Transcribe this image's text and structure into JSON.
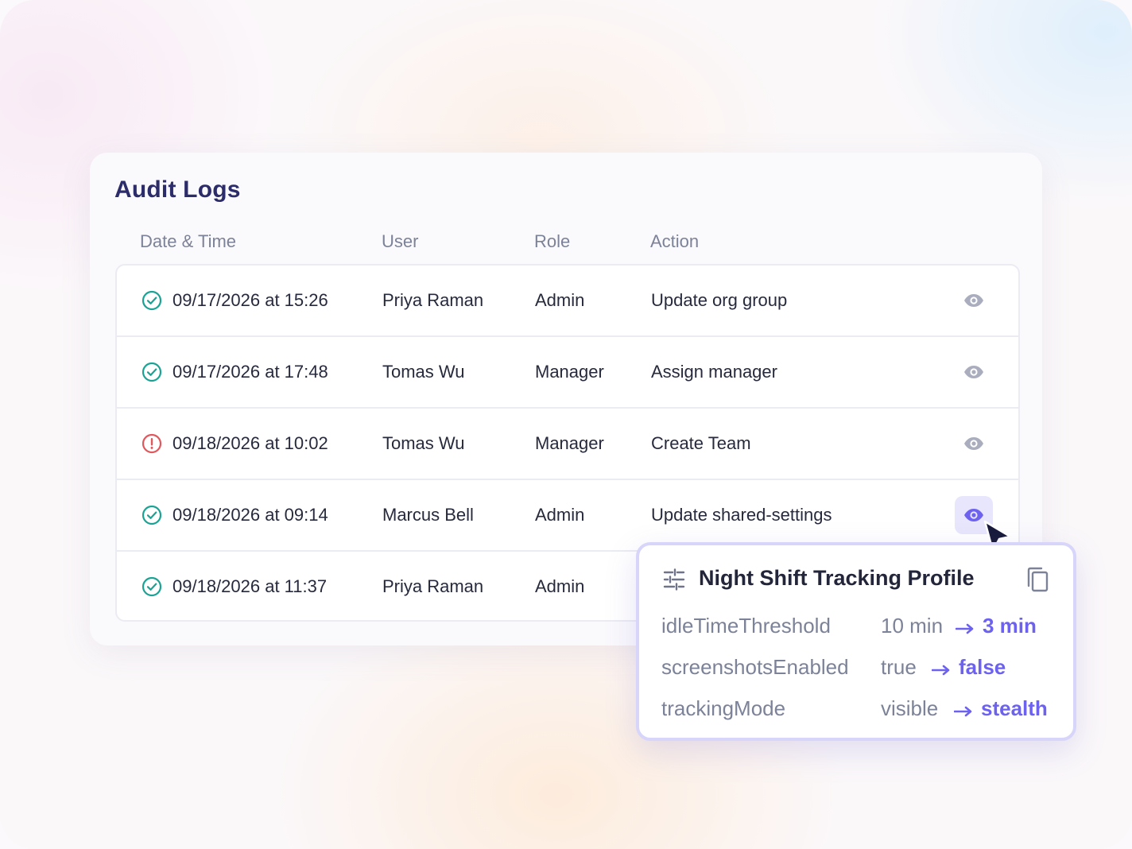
{
  "title": "Audit Logs",
  "columns": {
    "date": "Date & Time",
    "user": "User",
    "role": "Role",
    "action": "Action"
  },
  "rows": [
    {
      "status": "success",
      "date": "09/17/2026 at 15:26",
      "user": "Priya Raman",
      "role": "Admin",
      "action": "Update org group"
    },
    {
      "status": "success",
      "date": "09/17/2026 at 17:48",
      "user": "Tomas Wu",
      "role": "Manager",
      "action": "Assign manager"
    },
    {
      "status": "error",
      "date": "09/18/2026 at 10:02",
      "user": "Tomas Wu",
      "role": "Manager",
      "action": "Create Team"
    },
    {
      "status": "success",
      "date": "09/18/2026 at 09:14",
      "user": "Marcus Bell",
      "role": "Admin",
      "action": "Update shared-settings"
    },
    {
      "status": "success",
      "date": "09/18/2026 at 11:37",
      "user": "Priya Raman",
      "role": "Admin",
      "action": ""
    }
  ],
  "detail": {
    "title": "Night Shift Tracking Profile",
    "changes": [
      {
        "key": "idleTimeThreshold",
        "old": "10 min",
        "new": "3 min"
      },
      {
        "key": "screenshotsEnabled",
        "old": "true",
        "new": "false"
      },
      {
        "key": "trackingMode",
        "old": "visible",
        "new": "stealth"
      }
    ]
  },
  "icons": {
    "success": "check-circle-icon",
    "error": "alert-circle-icon",
    "view": "eye-icon",
    "settings": "tune-icon",
    "copy": "copy-icon",
    "arrow": "arrow-right-icon",
    "pointer": "cursor-pointer-icon"
  },
  "colors": {
    "title": "#2c2c6a",
    "success": "#1aa394",
    "error": "#e0575c",
    "accent": "#6d62f0",
    "muted": "#7c8298",
    "eye_inactive": "#a9adbd"
  }
}
